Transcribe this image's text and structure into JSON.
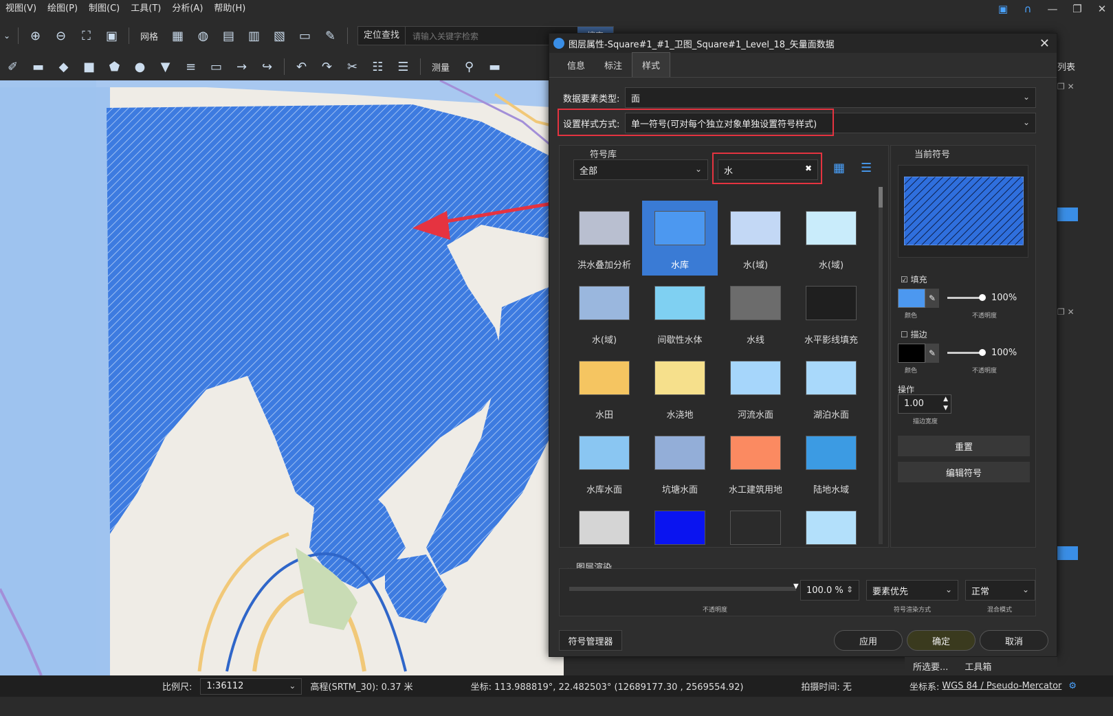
{
  "menu": [
    "视图(V)",
    "绘图(P)",
    "制图(C)",
    "工具(T)",
    "分析(A)",
    "帮助(H)"
  ],
  "toolbar1": {
    "grid_label": "网格",
    "locate_label": "定位查找",
    "search_placeholder": "请输入关键字检索",
    "search_button": "搜索"
  },
  "toolbar2": {
    "measure_label": "测量"
  },
  "right_panel": {
    "list_label": "列表"
  },
  "dialog": {
    "title": "图层属性-Square#1_#1_卫图_Square#1_Level_18_矢量面数据",
    "tabs": [
      "信息",
      "标注",
      "样式"
    ],
    "active_tab": "样式",
    "data_type_label": "数据要素类型:",
    "data_type_value": "面",
    "style_mode_label": "设置样式方式:",
    "style_mode_value": "单一符号(可对每个独立对象单独设置符号样式)",
    "symbol_lib_label": "符号库",
    "symbol_lib_value": "全部",
    "search_value": "水",
    "current_symbol_label": "当前符号",
    "fill_label": "填充",
    "fill_opacity": "100%",
    "color_caption": "颜色",
    "opacity_caption": "不透明度",
    "stroke_label": "描边",
    "stroke_opacity": "100%",
    "operation_label": "操作",
    "stroke_width": "1.00",
    "stroke_width_caption": "描边宽度",
    "reset_button": "重置",
    "edit_symbol_button": "编辑符号",
    "layer_render_label": "图层渲染",
    "render_opacity": "100.0 %",
    "render_opacity_caption": "不透明度",
    "render_mode": "要素优先",
    "render_mode_caption": "符号渲染方式",
    "blend_mode": "正常",
    "blend_mode_caption": "混合模式",
    "symbol_manager_button": "符号管理器",
    "apply_button": "应用",
    "ok_button": "确定",
    "cancel_button": "取消",
    "symbols": [
      {
        "name": "洪水叠加分析",
        "color": "#b9bfd0"
      },
      {
        "name": "水库",
        "color": "#4c98f0"
      },
      {
        "name": "水(域)",
        "color": "#c3d8f5"
      },
      {
        "name": "水(域)",
        "color": "#c9ecfb"
      },
      {
        "name": "水(域)",
        "color": "#9ab7de"
      },
      {
        "name": "间歇性水体",
        "color": "#7fd0f2"
      },
      {
        "name": "水线",
        "color": "#6c6c6c"
      },
      {
        "name": "水平影线填充",
        "color": "#1f1f1f"
      },
      {
        "name": "水田",
        "color": "#f5c561"
      },
      {
        "name": "水浇地",
        "color": "#f6e08c"
      },
      {
        "name": "河流水面",
        "color": "#a6d6fb"
      },
      {
        "name": "湖泊水面",
        "color": "#a9d9fb"
      },
      {
        "name": "水库水面",
        "color": "#8ac6f2"
      },
      {
        "name": "坑塘水面",
        "color": "#93aed8"
      },
      {
        "name": "水工建筑用地",
        "color": "#fb8a61"
      },
      {
        "name": "陆地水域",
        "color": "#3c9be3"
      },
      {
        "name": "",
        "color": "#d5d5d5"
      },
      {
        "name": "",
        "color": "#0a14f0"
      },
      {
        "name": "",
        "color": "#2b2b2b"
      },
      {
        "name": "",
        "color": "#b3e0fb"
      }
    ]
  },
  "bottom_tabs": [
    "所选要...",
    "工具箱"
  ],
  "status": {
    "scale_label": "比例尺:",
    "scale_value": "1:36112",
    "elevation": "高程(SRTM_30): 0.37 米",
    "coords": "坐标: 113.988819°, 22.482503° (12689177.30 , 2569554.92)",
    "capture_time": "拍摄时间: 无",
    "crs_label": "坐标系:",
    "crs_value": "WGS 84 / Pseudo-Mercator"
  },
  "colors": {
    "accent": "#3a7bd5",
    "highlight_red": "#e53340",
    "water_fill": "#3d7be0"
  }
}
